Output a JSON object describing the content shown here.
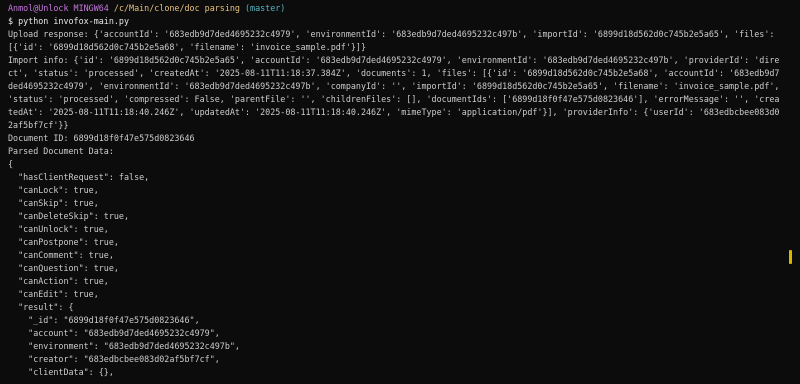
{
  "prompt": {
    "user": "Anmol@Unlock",
    "mingw": "MINGW64",
    "path": "/c/Main/clone/doc parsing",
    "branch": "(master)",
    "symbol": "$",
    "command": "python invofox-main.py"
  },
  "output": [
    "Upload response: {'accountId': '683edb9d7ded4695232c4979', 'environmentId': '683edb9d7ded4695232c497b', 'importId': '6899d18d562d0c745b2e5a65', 'files': [{'id': '6899d18d562d0c745b2e5a68', 'filename': 'invoice_sample.pdf'}]}",
    "Import info: {'id': '6899d18d562d0c745b2e5a65', 'accountId': '683edb9d7ded4695232c4979', 'environmentId': '683edb9d7ded4695232c497b', 'providerId': 'direct', 'status': 'processed', 'createdAt': '2025-08-11T11:18:37.384Z', 'documents': 1, 'files': [{'id': '6899d18d562d0c745b2e5a68', 'accountId': '683edb9d7ded4695232c4979', 'environmentId': '683edb9d7ded4695232c497b', 'companyId': '', 'importId': '6899d18d562d0c745b2e5a65', 'filename': 'invoice_sample.pdf', 'status': 'processed', 'compressed': False, 'parentFile': '', 'childrenFiles': [], 'documentIds': ['6899d18f0f47e575d0823646'], 'errorMessage': '', 'createdAt': '2025-08-11T11:18:40.246Z', 'updatedAt': '2025-08-11T11:18:40.246Z', 'mimeType': 'application/pdf'}], 'providerInfo': {'userId': '683edbcbee083d02af5bf7cf'}}",
    "Document ID: 6899d18f0f47e575d0823646",
    "Parsed Document Data:",
    "{",
    "  \"hasClientRequest\": false,",
    "  \"canLock\": true,",
    "  \"canSkip\": true,",
    "  \"canDeleteSkip\": true,",
    "  \"canUnlock\": true,",
    "  \"canPostpone\": true,",
    "  \"canComment\": true,",
    "  \"canQuestion\": true,",
    "  \"canAction\": true,",
    "  \"canEdit\": true,",
    "  \"result\": {",
    "    \"_id\": \"6899d18f0f47e575d0823646\",",
    "    \"account\": \"683edb9d7ded4695232c4979\",",
    "    \"environment\": \"683edb9d7ded4695232c497b\",",
    "    \"creator\": \"683edbcbee083d02af5bf7cf\",",
    "    \"clientData\": {},"
  ],
  "colors": {
    "background": "#0c0c0c",
    "text": "#cccccc",
    "user": "#c678dd",
    "path": "#e5c07b",
    "branch": "#56b6c2",
    "scroll_marker": "#d7b800"
  }
}
